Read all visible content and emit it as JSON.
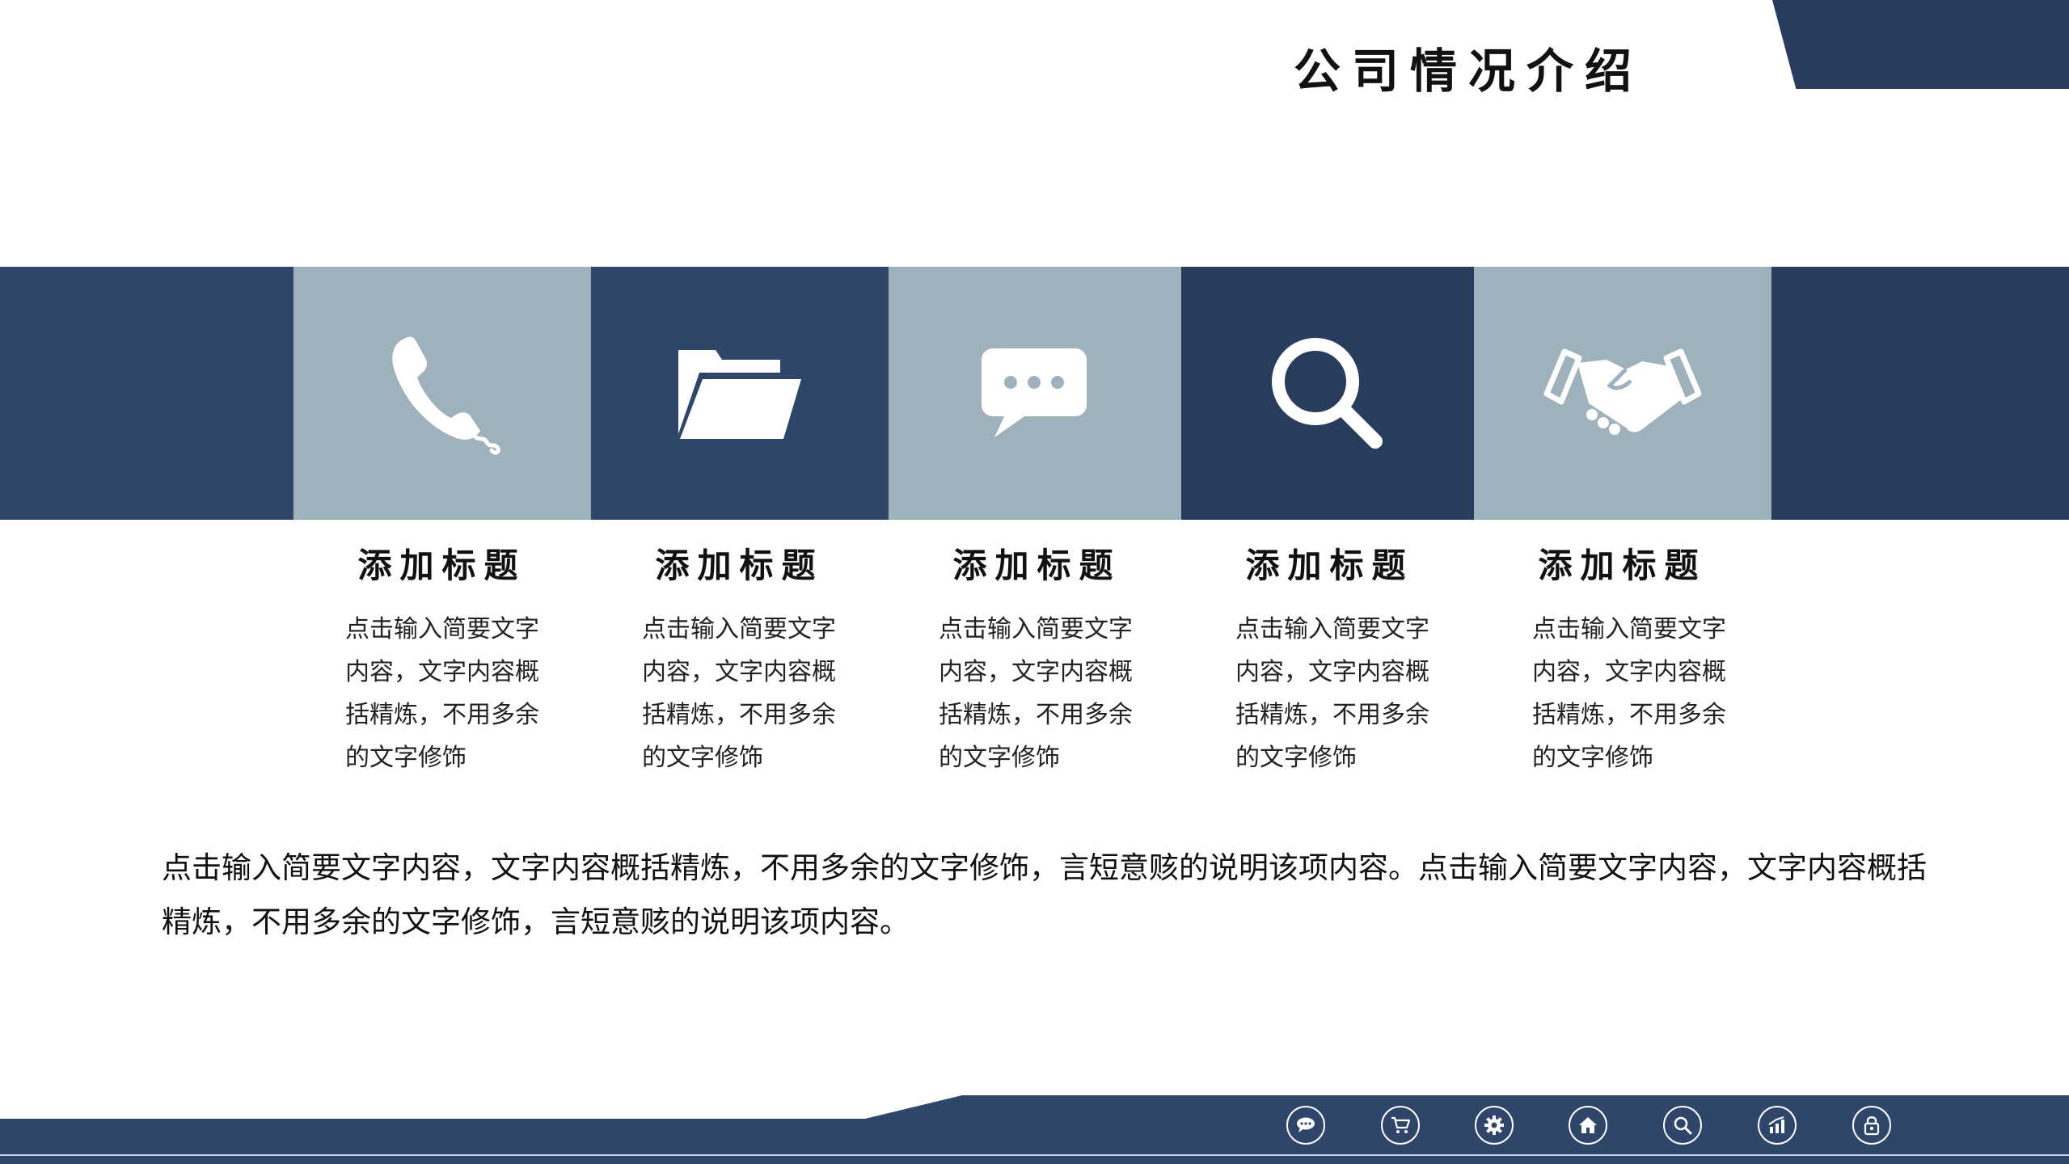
{
  "header": {
    "title": "公司情况介绍"
  },
  "colors": {
    "navy": "#2f4569",
    "dark_navy": "#2a3c5e",
    "grey_blue": "#9fb1ba",
    "footer": "#2f4569"
  },
  "cards": [
    {
      "icon": "phone-icon",
      "title": "添加标题",
      "desc": [
        "点击输入简要文字",
        "内容，文字内容概",
        "括精炼，不用多余",
        "的文字修饰"
      ]
    },
    {
      "icon": "folder-icon",
      "title": "添加标题",
      "desc": [
        "点击输入简要文字",
        "内容，文字内容概",
        "括精炼，不用多余",
        "的文字修饰"
      ]
    },
    {
      "icon": "chat-bubble-icon",
      "title": "添加标题",
      "desc": [
        "点击输入简要文字",
        "内容，文字内容概",
        "括精炼，不用多余",
        "的文字修饰"
      ]
    },
    {
      "icon": "magnifier-icon",
      "title": "添加标题",
      "desc": [
        "点击输入简要文字",
        "内容，文字内容概",
        "括精炼，不用多余",
        "的文字修饰"
      ]
    },
    {
      "icon": "handshake-icon",
      "title": "添加标题",
      "desc": [
        "点击输入简要文字",
        "内容，文字内容概",
        "括精炼，不用多余",
        "的文字修饰"
      ]
    }
  ],
  "paragraph": "点击输入简要文字内容，文字内容概括精炼，不用多余的文字修饰，言短意赅的说明该项内容。点击输入简要文字内容，文字内容概括精炼，不用多余的文字修饰，言短意赅的说明该项内容。",
  "footer_nav": [
    {
      "icon": "chat-icon"
    },
    {
      "icon": "cart-icon"
    },
    {
      "icon": "gear-icon"
    },
    {
      "icon": "home-icon"
    },
    {
      "icon": "search-icon"
    },
    {
      "icon": "chart-icon"
    },
    {
      "icon": "lock-icon"
    }
  ]
}
